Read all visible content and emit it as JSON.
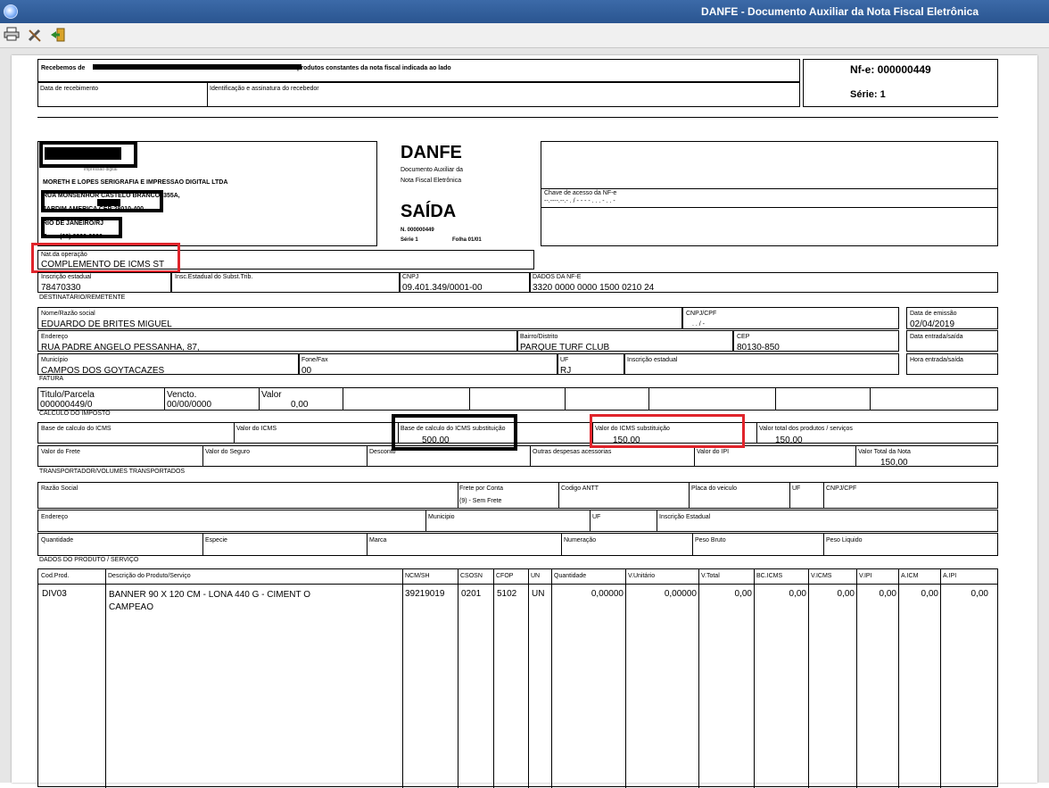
{
  "window": {
    "title": "DANFE - Documento Auxiliar da Nota Fiscal Eletrônica"
  },
  "toolbar": {
    "icons": [
      "printer-icon",
      "tools-icon",
      "exit-icon"
    ]
  },
  "canhoto": {
    "recebemos": "Recebemos de",
    "recebemos_tail": "produtos constantes da nota fiscal indicada ao lado",
    "data_recebimento": "Data de recebimento",
    "identificacao": "Identificação e assinatura do recebedor",
    "nfe": "Nf-e: 000000449",
    "serie": "Série: 1"
  },
  "emitente": {
    "sublogo": "impressao digital",
    "nome": "MORETH E LOPES SERIGRAFIA E IMPRESSAO DIGITAL LTDA",
    "endereco": "RUA MONSENHOR CASTELO BRANCO, 355A,",
    "bairro": "JARDIM AMERICA CEP:28010-400",
    "cidade": "RIO DE JANEIRO/RJ",
    "fone": "Fone:(00) 0000-0000"
  },
  "danfe": {
    "title": "DANFE",
    "sub1": "Documento Auxiliar da",
    "sub2": "Nota Fiscal Eletrônica",
    "tipo": "SAÍDA",
    "numero": "N. 000000449",
    "serie": "Série 1",
    "folha": "Folha 01/01"
  },
  "chave": {
    "label": "Chave de acesso da NF-e",
    "value": "--.----.--.-  .  /     -   -  -  -   .   .   .   -   .   .   -"
  },
  "natureza": {
    "label": "Nat.da operação",
    "value": "COMPLEMENTO DE ICMS ST"
  },
  "ie": {
    "ie_label": "Inscrição estadual",
    "ie_value": "78470330",
    "ie_st_label": "Insc.Estadual do Subst.Trib.",
    "cnpj_label": "CNPJ",
    "cnpj_value": "09.401.349/0001-00",
    "dados_label": "DADOS DA NF-E",
    "dados_value": "3320 0000 0000 1500 0210 24"
  },
  "destinatario": {
    "section": "DESTINATÁRIO/REMETENTE",
    "nome_label": "Nome/Razão social",
    "nome": "EDUARDO DE BRITES MIGUEL",
    "cnpj_label": "CNPJ/CPF",
    "cnpj": ". .  /   -",
    "emissao_label": "Data de emissão",
    "emissao": "02/04/2019",
    "endereco_label": "Endereço",
    "endereco": "RUA PADRE ANGELO PESSANHA, 87,",
    "bairro_label": "Bairro/Distrito",
    "bairro": "PARQUE TURF CLUB",
    "cep_label": "CEP",
    "cep": "80130-850",
    "entrada_label": "Data entrada/saída",
    "municipio_label": "Município",
    "municipio": "CAMPOS DOS GOYTACAZES",
    "fone_label": "Fone/Fax",
    "fone": "00",
    "uf_label": "UF",
    "uf": "RJ",
    "ie_label": "Inscrição estadual",
    "hora_label": "Hora entrada/saída"
  },
  "fatura": {
    "section": "FATURA",
    "titulo_label": "Titulo/Parcela",
    "titulo": "000000449/0",
    "vencto_label": "Vencto.",
    "vencto": "00/00/0000",
    "valor_label": "Valor",
    "valor": "0,00"
  },
  "imposto": {
    "section": "CALCULO DO IMPOSTO",
    "bc_icms": "Base de calculo do ICMS",
    "v_icms": "Valor do ICMS",
    "bc_st_label": "Base de calculo do ICMS substituição",
    "bc_st": "500,00",
    "v_st_label": "Valor do ICMS substituição",
    "v_st": "150,00",
    "v_prod_label": "Valor total dos produtos / serviços",
    "v_prod": "150,00",
    "frete": "Valor do Frete",
    "seguro": "Valor do Seguro",
    "desconto": "Desconto",
    "outras": "Outras despesas acessorias",
    "ipi": "Valor do IPI",
    "v_nota_label": "Valor Total da Nota",
    "v_nota": "150,00"
  },
  "transportador": {
    "section": "TRANSPORTADOR/VOLUMES TRANSPORTADOS",
    "razao": "Razão Social",
    "frete_label": "Frete por Conta",
    "frete_value": "(9) - Sem Frete",
    "antt": "Codigo ANTT",
    "placa": "Placa do veiculo",
    "uf": "UF",
    "cnpj": "CNPJ/CPF",
    "endereco": "Endereço",
    "municipio": "Municipio",
    "uf2": "UF",
    "ie": "Inscrição Estadual",
    "quantidade": "Quantidade",
    "especie": "Especie",
    "marca": "Marca",
    "numeracao": "Numeração",
    "peso_bruto": "Peso Bruto",
    "peso_liquido": "Peso Liquido"
  },
  "produtos": {
    "section": "DADOS DO PRODUTO / SERVIÇO",
    "headers": [
      "Cod.Prod.",
      "Descrição do Produto/Serviço",
      "NCM/SH",
      "CSOSN",
      "CFOP",
      "UN",
      "Quantidade",
      "V.Unitário",
      "V.Total",
      "BC.ICMS",
      "V.ICMS",
      "V.IPI",
      "A.ICM",
      "A.IPI"
    ],
    "row": [
      "DIV03",
      "BANNER 90 X 120 CM - LONA 440 G - CIMENT O CAMPEAO",
      "39219019",
      "0201",
      "5102",
      "UN",
      "0,00000",
      "0,00000",
      "0,00",
      "0,00",
      "0,00",
      "0,00",
      "0,00",
      "0,00"
    ]
  },
  "annotations": {
    "red": "#e0242b",
    "black": "#000000"
  }
}
